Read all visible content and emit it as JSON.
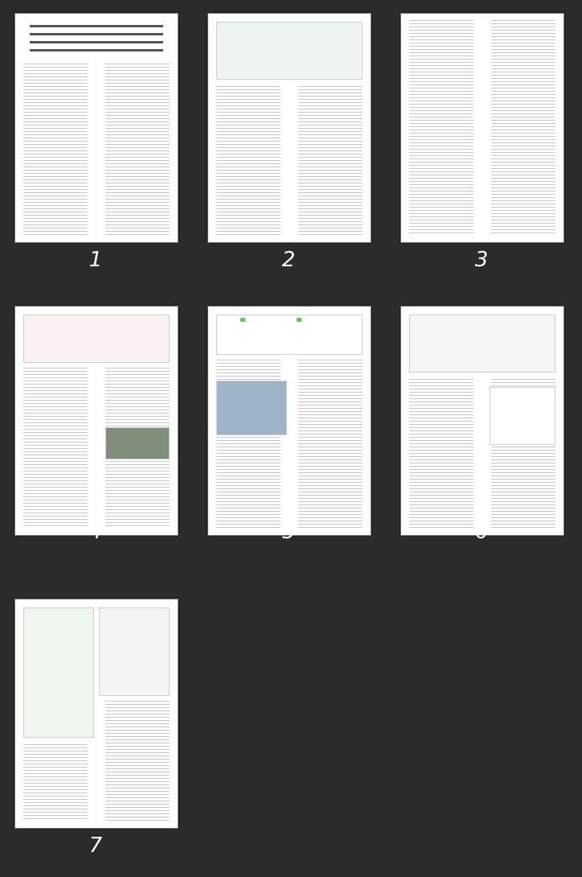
{
  "viewer": {
    "pages": [
      {
        "label": "1"
      },
      {
        "label": "2"
      },
      {
        "label": "3"
      },
      {
        "label": "4"
      },
      {
        "label": "5"
      },
      {
        "label": "6"
      },
      {
        "label": "7"
      }
    ]
  }
}
